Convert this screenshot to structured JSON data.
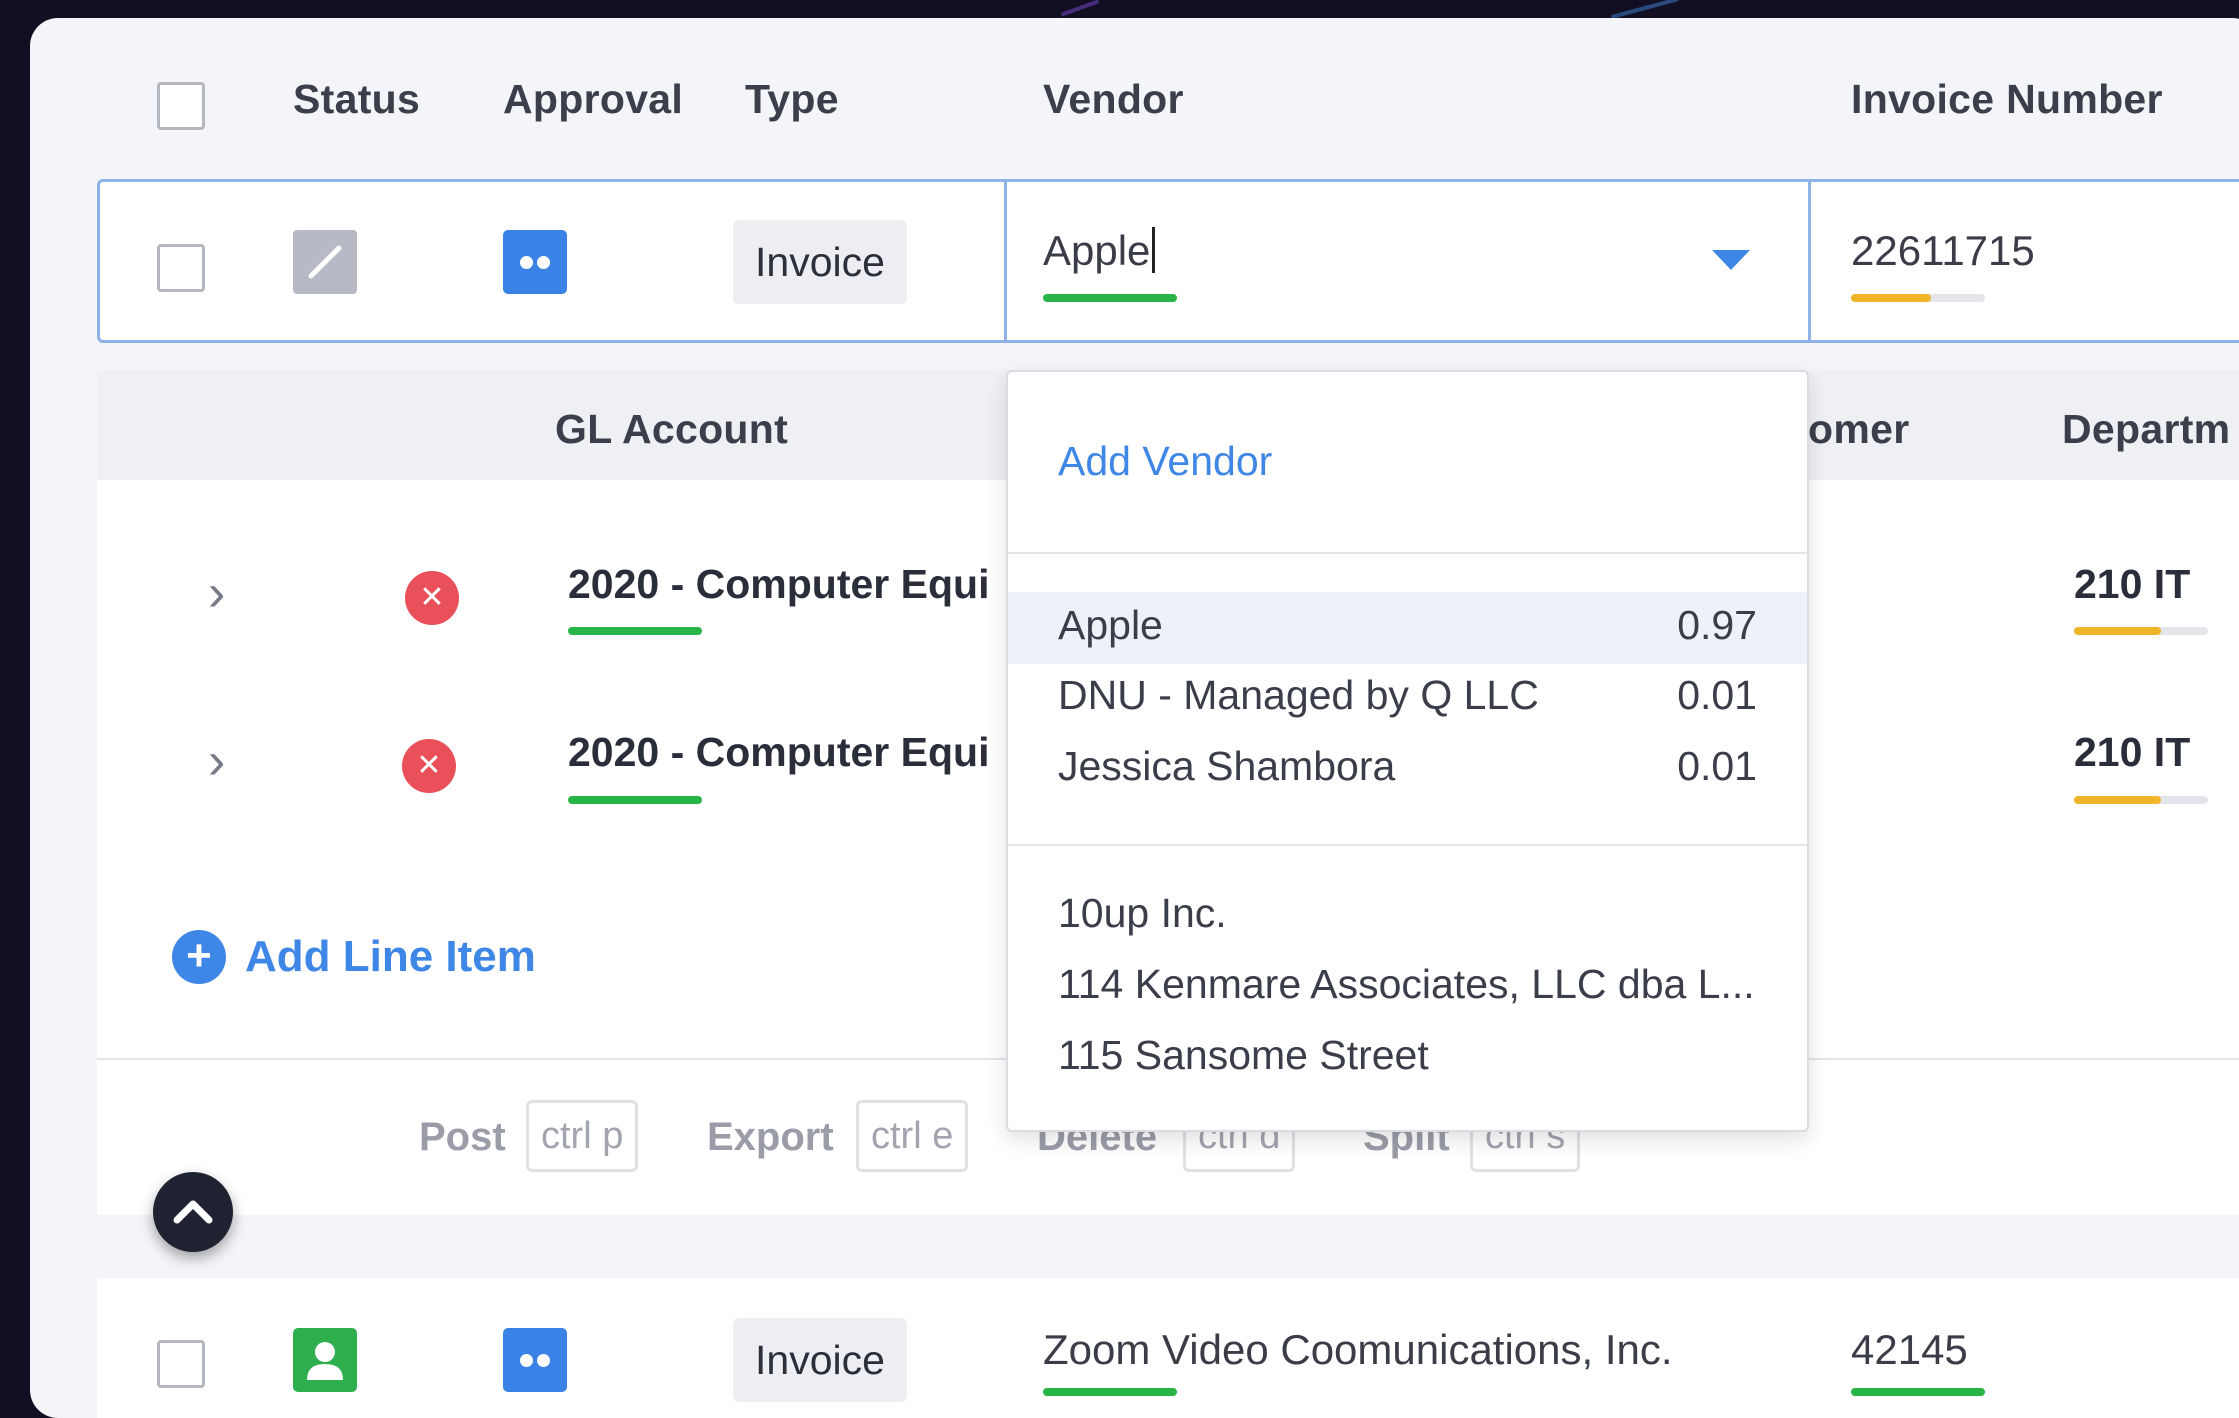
{
  "colors": {
    "background": "#120f24",
    "accent_blue": "#3f87e6",
    "status_green": "#28b446",
    "status_yellow": "#f0b429",
    "error_red": "#e9505a"
  },
  "table": {
    "headers": {
      "status": "Status",
      "approval": "Approval",
      "type": "Type",
      "vendor": "Vendor",
      "invoice_number": "Invoice Number"
    }
  },
  "row1": {
    "status_icon": "edit-icon",
    "approval_icon": "two-dots-icon",
    "type": "Invoice",
    "vendor_input": "Apple",
    "vendor_confidence": 1.0,
    "invoice_number": "22611715",
    "invoice_confidence": 0.6
  },
  "detail": {
    "headers": {
      "gl_account": "GL Account",
      "customer_partial": "omer",
      "department_partial": "Departm"
    },
    "lines": [
      {
        "gl": "2020 - Computer Equi",
        "department": "210 IT",
        "status_icon": "x-circle-icon"
      },
      {
        "gl": "2020 - Computer Equi",
        "department": "210 IT",
        "status_icon": "x-circle-icon"
      }
    ],
    "add_line_item": "Add Line Item"
  },
  "shortcuts": [
    {
      "label": "Post",
      "key": "ctrl p"
    },
    {
      "label": "Export",
      "key": "ctrl e"
    },
    {
      "label": "Delete",
      "key": "ctrl d"
    },
    {
      "label": "Split",
      "key": "ctrl s"
    }
  ],
  "dropdown": {
    "add_vendor": "Add Vendor",
    "suggestions": [
      {
        "name": "Apple",
        "score": "0.97"
      },
      {
        "name": "DNU - Managed by Q LLC",
        "score": "0.01"
      },
      {
        "name": "Jessica Shambora",
        "score": "0.01"
      }
    ],
    "all_vendors": [
      "10up Inc.",
      "114 Kenmare Associates, LLC dba L...",
      "115 Sansome Street"
    ]
  },
  "row2": {
    "status_icon": "person-icon",
    "approval_icon": "two-dots-icon",
    "type": "Invoice",
    "vendor": "Zoom Video Coomunications, Inc.",
    "invoice_number": "42145"
  }
}
